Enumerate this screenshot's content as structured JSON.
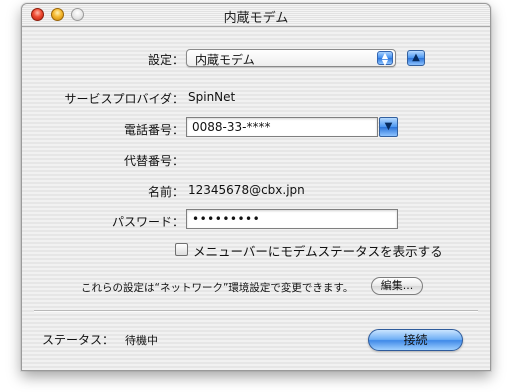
{
  "window": {
    "title": "内蔵モデム"
  },
  "settings": {
    "label": "設定：",
    "value": "内蔵モデム"
  },
  "provider": {
    "label": "サービスプロバイダ：",
    "value": "SpinNet"
  },
  "phone": {
    "label": "電話番号：",
    "value": "0088-33-****"
  },
  "alt_phone": {
    "label": "代替番号："
  },
  "name": {
    "label": "名前：",
    "value": "12345678@cbx.jpn"
  },
  "password": {
    "label": "パスワード：",
    "value": "•••••••••"
  },
  "menubar_checkbox": {
    "label": "メニューバーにモデムステータスを表示する",
    "checked": false
  },
  "note": {
    "text": "これらの設定は“ネットワーク”環境設定で変更できます。",
    "edit_label": "編集..."
  },
  "status": {
    "label": "ステータス：",
    "value": "待機中",
    "connect_label": "接続"
  },
  "icons": {
    "popup_arrows": "up-down-arrows-icon",
    "disclosure": "triangle-up-icon",
    "combo": "triangle-down-icon"
  },
  "colors": {
    "accent_blue": "#4a96f1",
    "close_red": "#ee4a32",
    "minimize_yellow": "#f5b930"
  }
}
